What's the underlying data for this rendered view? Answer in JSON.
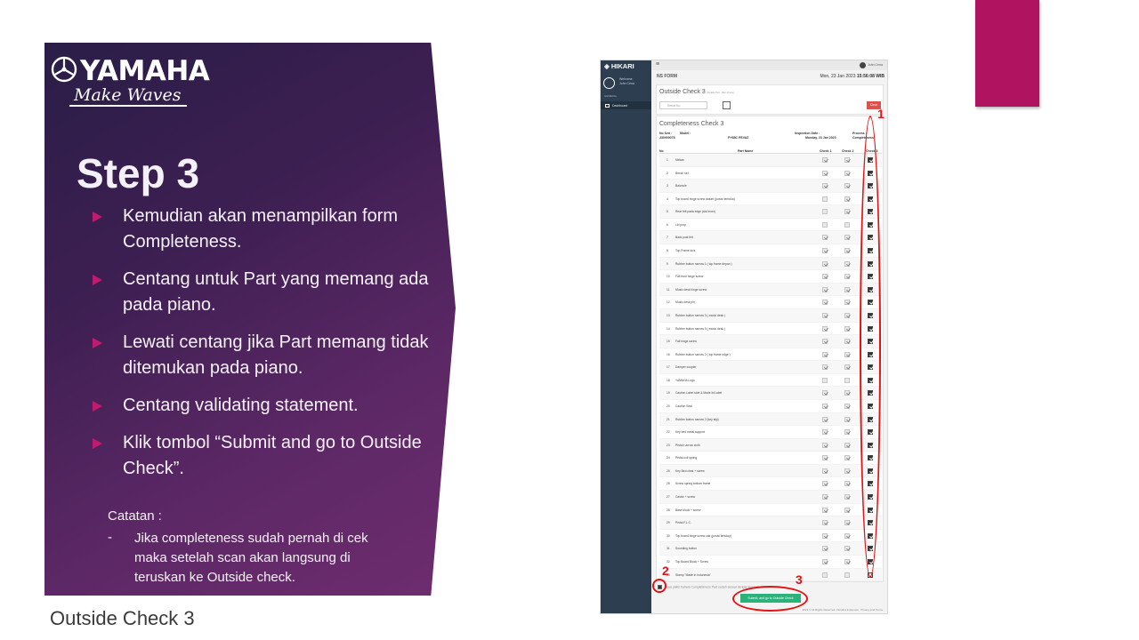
{
  "slide": {
    "brand": "YAMAHA",
    "tagline": "Make Waves",
    "step_title": "Step 3",
    "bullets": [
      "Kemudian akan menampilkan form Completeness.",
      "Centang untuk Part yang memang ada pada piano.",
      "Lewati centang jika Part memang tidak ditemukan pada piano.",
      "Centang validating statement.",
      "Klik tombol “Submit and go to Outside Check”."
    ],
    "note_head": "Catatan :",
    "note_dash": "-",
    "note_body": "Jika completeness sudah pernah di cek maka setelah scan akan langsung di teruskan ke Outside check.",
    "footer_title": "Outside Check 3",
    "colors": {
      "accent": "#c01b6c",
      "magenta_block": "#b0135f",
      "annotation": "#e01414"
    }
  },
  "screenshot": {
    "brand": "HIKARI",
    "welcome": "Welcome,",
    "user": "John Cena",
    "section": "GENERAL",
    "nav_item": "Dashboard",
    "menu_glyph": "≡",
    "top_user": "John Cena",
    "form_name": "NS FORM",
    "date": "Mon, 23 Jan 2023",
    "time": "15:56:08 WIB",
    "oc_title": "Outside Check 3",
    "oc_sub": "(Outside Part - Main Frame)",
    "serial_placeholder": "Serial No",
    "clear_label": "Clear",
    "cc_title": "Completeness Check 3",
    "meta": {
      "no_seri_label": "No Seri :",
      "no_seri": "J30000078",
      "model_label": "Model :",
      "model": "PY68C PE//AZ",
      "inspection_label": "Inspection Date :",
      "inspection": "Monday, 23 Jan 2023",
      "process_label": "Process :",
      "process": "Completeness"
    },
    "headers": {
      "no": "No",
      "part": "Part Name",
      "c1": "Check 1",
      "c2": "Check 2",
      "c3": "Check 3"
    },
    "parts": [
      {
        "no": "1",
        "name": "Mekan",
        "c1": true,
        "c2": true,
        "c3": true
      },
      {
        "no": "2",
        "name": "Bench set",
        "c1": true,
        "c2": true,
        "c3": true
      },
      {
        "no": "3",
        "name": "Baloncle",
        "c1": true,
        "c2": true,
        "c3": true
      },
      {
        "no": "4",
        "name": "Top board hinge screw datum (posisi terbuka)",
        "c1": false,
        "c2": true,
        "c3": true
      },
      {
        "no": "5",
        "name": "Rear felt pada edge (sisi inner)",
        "c1": false,
        "c2": true,
        "c3": true
      },
      {
        "no": "6",
        "name": "Lid prop",
        "c1": false,
        "c2": false,
        "c3": true
      },
      {
        "no": "7",
        "name": "Back post felt",
        "c1": true,
        "c2": true,
        "c3": true
      },
      {
        "no": "8",
        "name": "Top Frame kick",
        "c1": true,
        "c2": true,
        "c3": true
      },
      {
        "no": "9",
        "name": "Rubber button narrow 1 ( top frame depan )",
        "c1": true,
        "c2": true,
        "c3": true
      },
      {
        "no": "10",
        "name": "Fall front hinge screw",
        "c1": true,
        "c2": true,
        "c3": true
      },
      {
        "no": "11",
        "name": "Music desk hinge screw",
        "c1": true,
        "c2": true,
        "c3": true
      },
      {
        "no": "12",
        "name": "Music desk pin",
        "c1": true,
        "c2": true,
        "c3": true
      },
      {
        "no": "13",
        "name": "Rubber button narrow 3 ( music desk )",
        "c1": true,
        "c2": true,
        "c3": true
      },
      {
        "no": "14",
        "name": "Rubber button narrow 9 ( music desk )",
        "c1": true,
        "c2": true,
        "c3": true
      },
      {
        "no": "15",
        "name": "Fall hinge screw",
        "c1": true,
        "c2": true,
        "c3": true
      },
      {
        "no": "16",
        "name": "Rubber button narrow 2 ( top frame edge )",
        "c1": true,
        "c2": true,
        "c3": true
      },
      {
        "no": "17",
        "name": "Damper coupler",
        "c1": true,
        "c2": true,
        "c3": true
      },
      {
        "no": "18",
        "name": "YAMAHA Logo",
        "c1": false,
        "c2": false,
        "c3": true
      },
      {
        "no": "19",
        "name": "Caution Label side & Made In/Label",
        "c1": true,
        "c2": true,
        "c3": true
      },
      {
        "no": "20",
        "name": "Caution Seal",
        "c1": true,
        "c2": true,
        "c3": true
      },
      {
        "no": "21",
        "name": "Rubber button narrow 2 (key slip)",
        "c1": true,
        "c2": true,
        "c3": true
      },
      {
        "no": "22",
        "name": "Key bed metal support",
        "c1": true,
        "c2": true,
        "c3": true
      },
      {
        "no": "23",
        "name": "Pedal r-arrow cloth",
        "c1": true,
        "c2": true,
        "c3": true
      },
      {
        "no": "24",
        "name": "Pedal coil spring",
        "c1": true,
        "c2": true,
        "c3": true
      },
      {
        "no": "25",
        "name": "Key Bed cleat + screw",
        "c1": true,
        "c2": true,
        "c3": true
      },
      {
        "no": "26",
        "name": "Screw spring bottom frame",
        "c1": true,
        "c2": true,
        "c3": true
      },
      {
        "no": "27",
        "name": "Castor + screw",
        "c1": true,
        "c2": true,
        "c3": true
      },
      {
        "no": "28",
        "name": "Base block + screw",
        "c1": true,
        "c2": true,
        "c3": true
      },
      {
        "no": "29",
        "name": "Pedal F.L.C.",
        "c1": true,
        "c2": true,
        "c3": true
      },
      {
        "no": "30",
        "name": "Top board hinge screw cair (posisi tertutup)",
        "c1": true,
        "c2": true,
        "c3": true
      },
      {
        "no": "31",
        "name": "Sounding button",
        "c1": true,
        "c2": true,
        "c3": true
      },
      {
        "no": "32",
        "name": "Top Board Block + Screw",
        "c1": true,
        "c2": true,
        "c3": true
      },
      {
        "no": "33",
        "name": "Stamp \"Made in Indonesia\"",
        "c1": false,
        "c2": false,
        "c3": false
      }
    ],
    "validate_text": "Saya yakin bahwa Completeness Part sudah sesuai dengan kenyataan",
    "submit_label": "Submit, and go to Outside Check",
    "footer": "2023 © All Rights Reserved. Yamaha Indonesia · Privacy and Terms"
  },
  "annotations": {
    "a1": "1",
    "a2": "2",
    "a3": "3"
  }
}
